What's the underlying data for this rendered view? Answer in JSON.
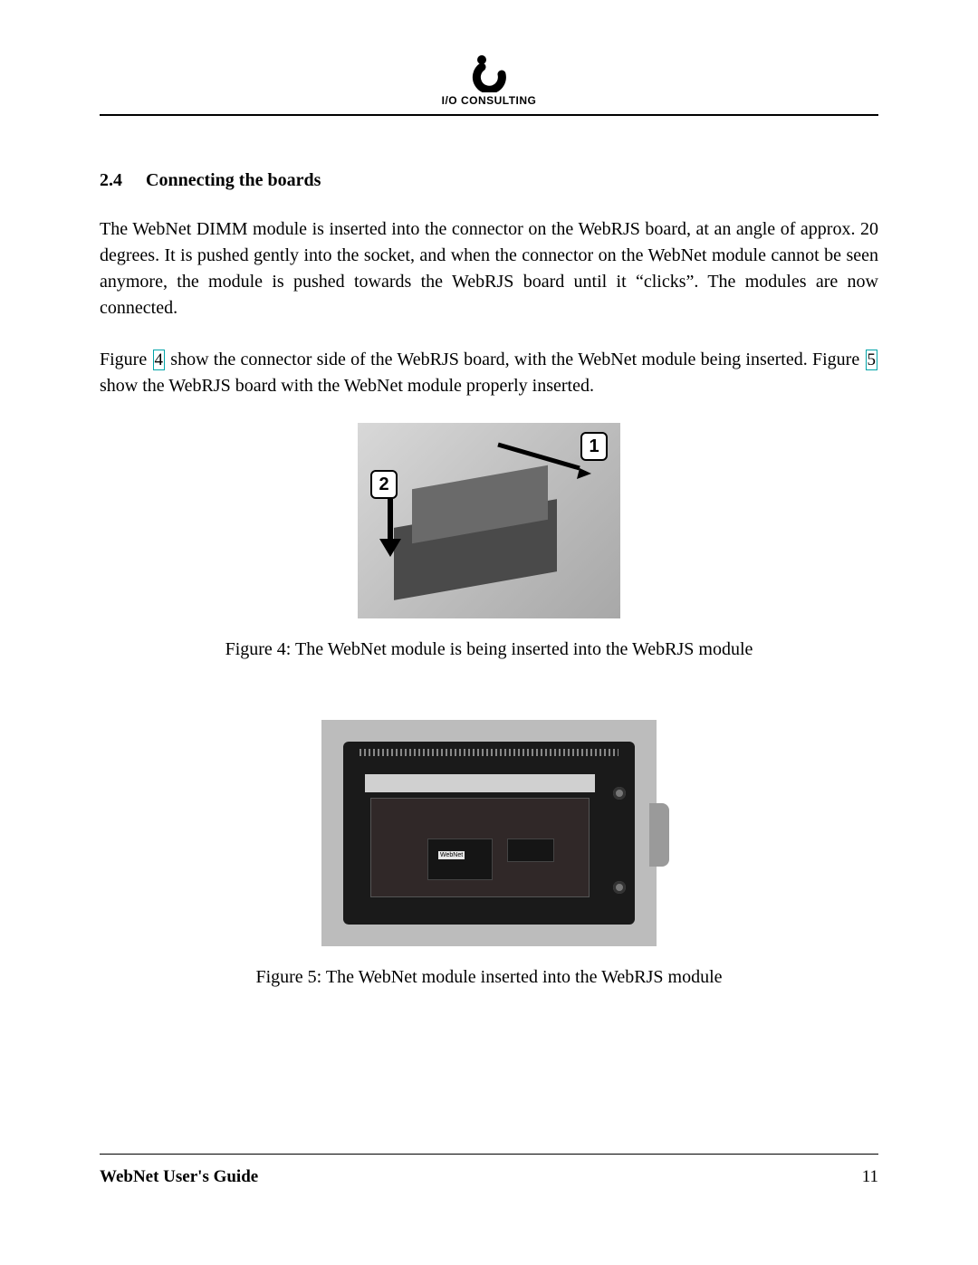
{
  "header": {
    "brand": "I/O CONSULTING"
  },
  "section": {
    "number": "2.4",
    "title": "Connecting the boards"
  },
  "paragraphs": {
    "p1": "The WebNet DIMM module is inserted into the connector on the WebRJS board, at an angle of approx. 20 degrees. It is pushed gently into the socket, and when the connector on the WebNet module cannot be seen anymore, the module is pushed towards the WebRJS board until it “clicks”. The modules are now connected.",
    "p2a": "Figure ",
    "p2_link1": "4",
    "p2b": " show the connector side of the WebRJS board, with the WebNet module being inserted. Figure ",
    "p2_link2": "5",
    "p2c": " show the WebRJS board with the WebNet module properly inserted."
  },
  "figures": {
    "fig4": {
      "callout1": "1",
      "callout2": "2",
      "caption": "Figure 4: The WebNet module is being inserted into the WebRJS module"
    },
    "fig5": {
      "caption": "Figure 5: The WebNet module inserted into the WebRJS module"
    }
  },
  "footer": {
    "title": "WebNet User's Guide",
    "page": "11"
  }
}
